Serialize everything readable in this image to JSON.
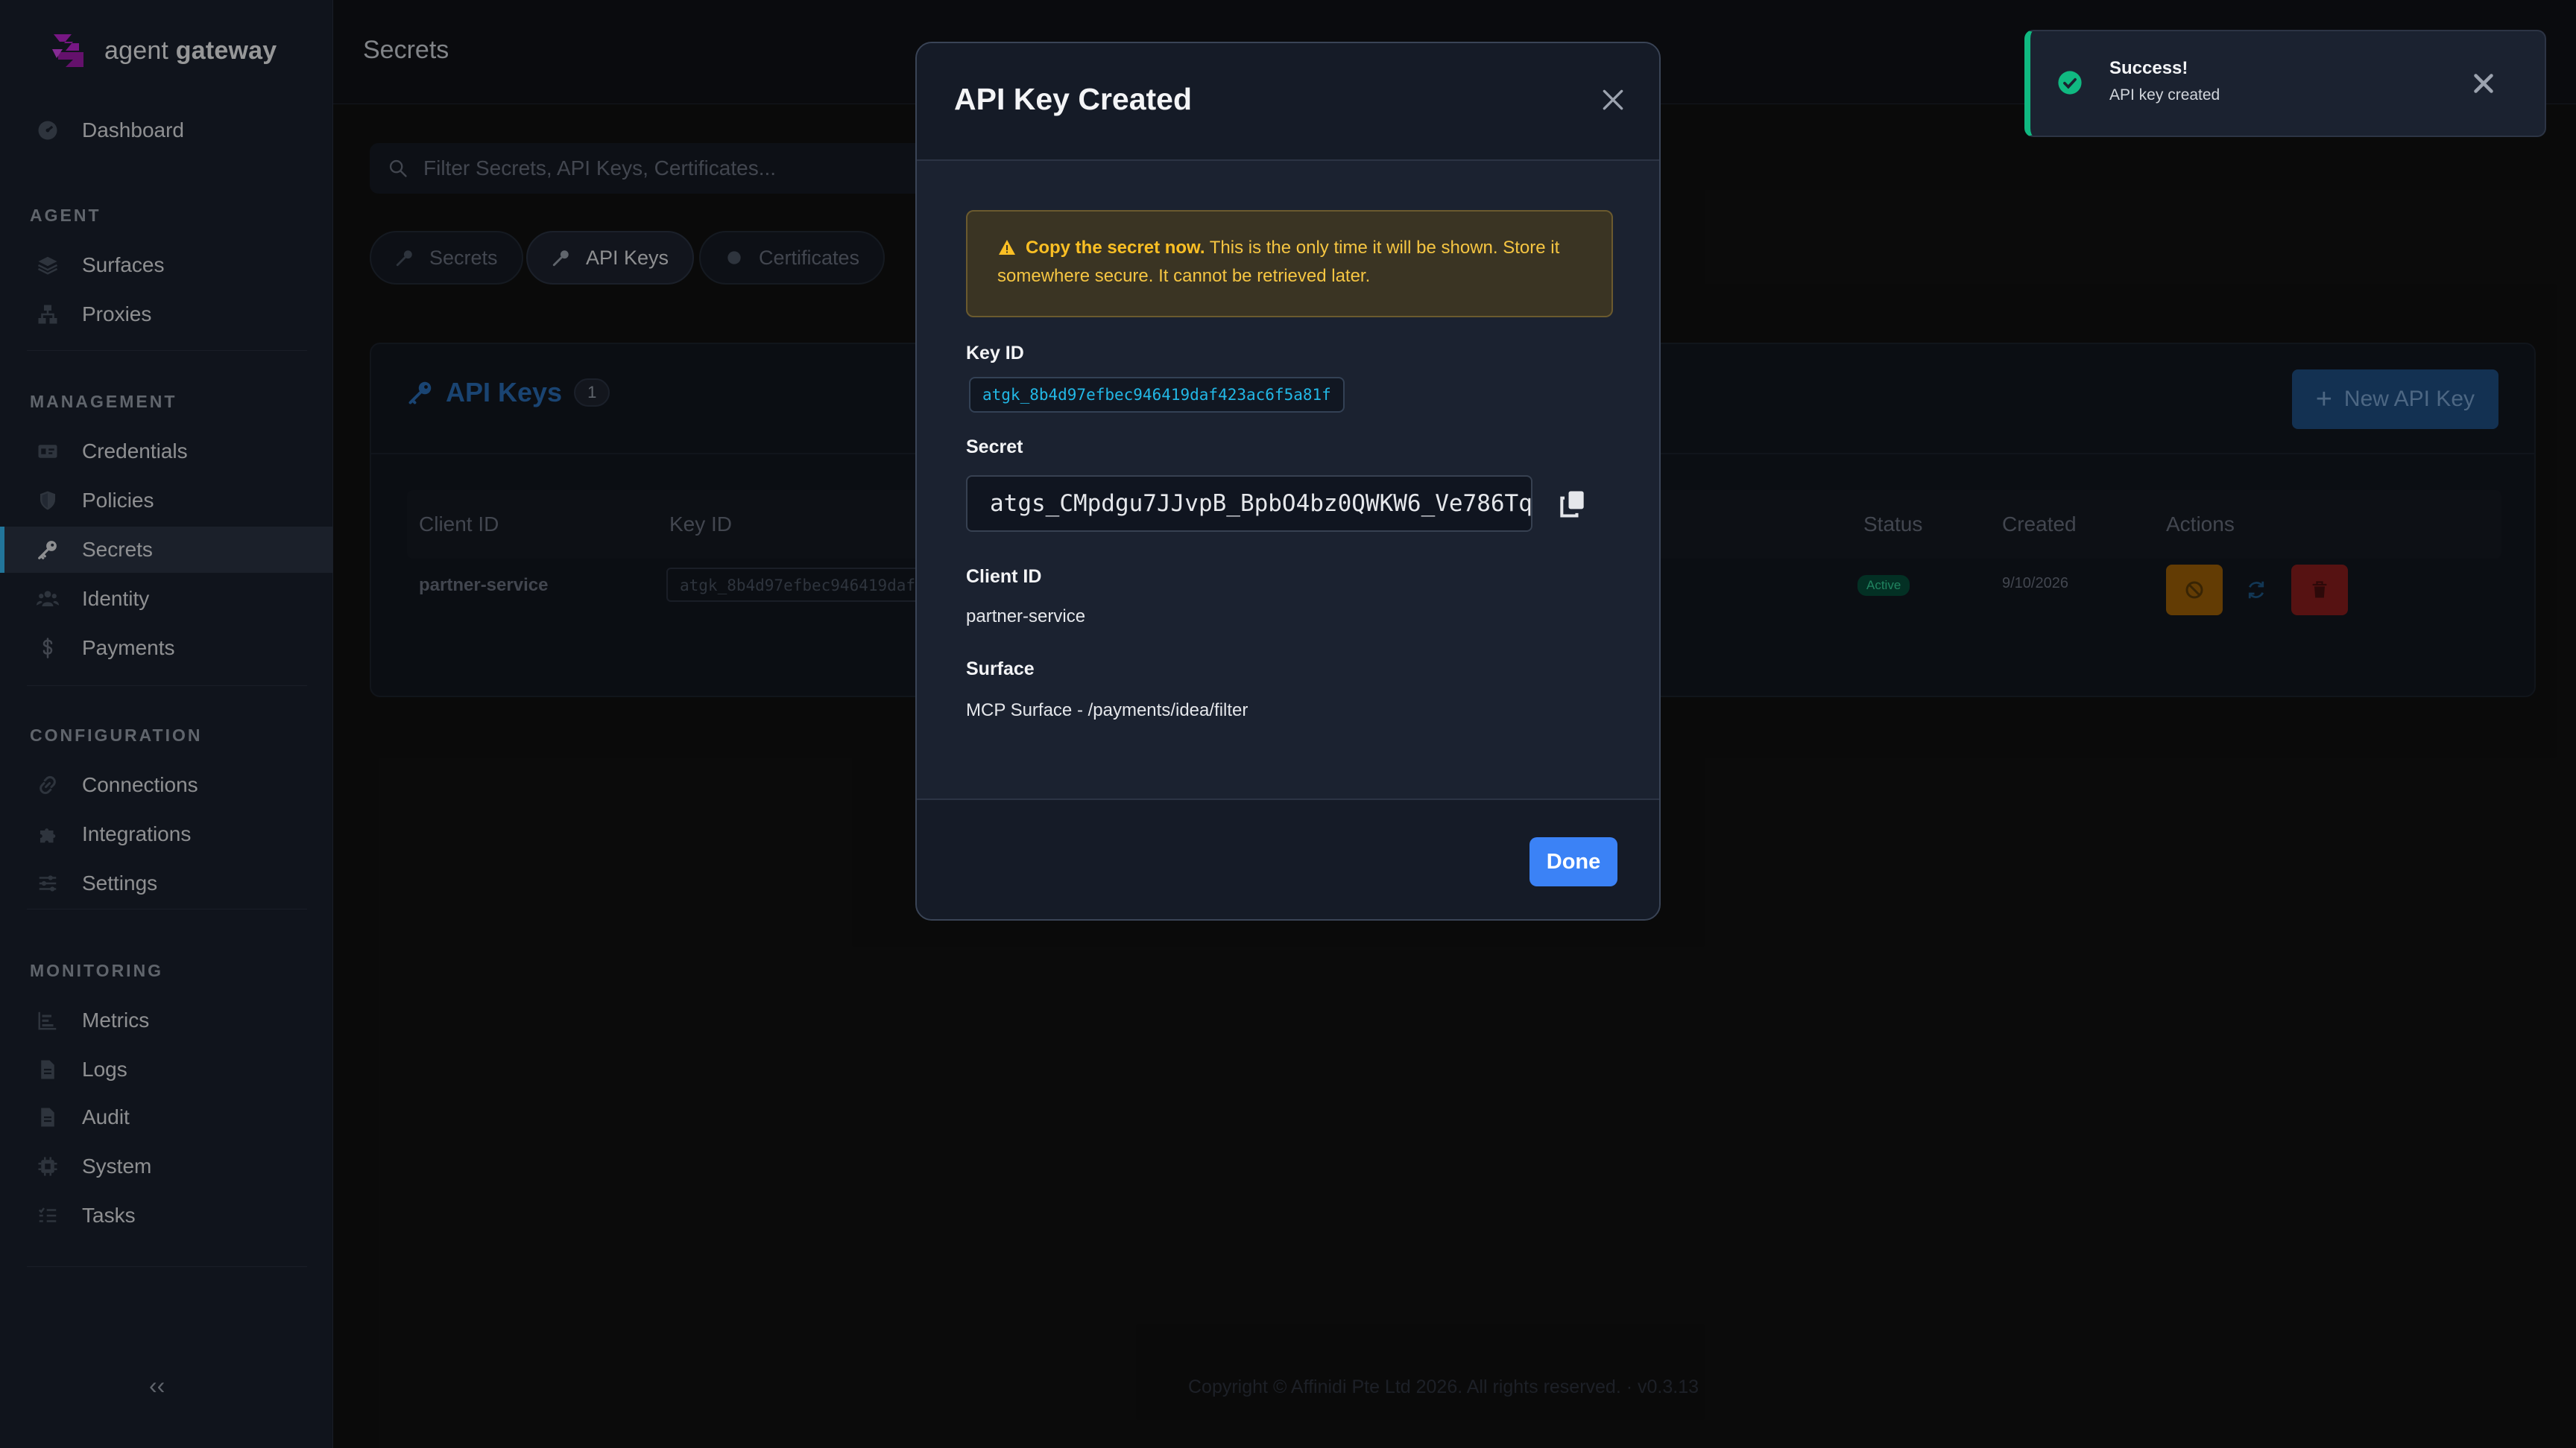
{
  "brand": {
    "name_light": "agent",
    "name_bold": "gateway"
  },
  "sidebar": {
    "dashboard": {
      "label": "Dashboard",
      "icon": "dashboard-icon"
    },
    "sections": [
      {
        "title": "AGENT",
        "items": [
          {
            "label": "Surfaces",
            "icon": "layers-icon"
          },
          {
            "label": "Proxies",
            "icon": "network-icon"
          }
        ]
      },
      {
        "title": "MANAGEMENT",
        "items": [
          {
            "label": "Credentials",
            "icon": "id-card-icon"
          },
          {
            "label": "Policies",
            "icon": "shield-icon"
          },
          {
            "label": "Secrets",
            "icon": "key-icon",
            "active": true
          },
          {
            "label": "Identity",
            "icon": "users-icon"
          },
          {
            "label": "Payments",
            "icon": "dollar-icon"
          }
        ]
      },
      {
        "title": "CONFIGURATION",
        "items": [
          {
            "label": "Connections",
            "icon": "link-icon"
          },
          {
            "label": "Integrations",
            "icon": "puzzle-icon"
          },
          {
            "label": "Settings",
            "icon": "sliders-icon"
          }
        ]
      },
      {
        "title": "MONITORING",
        "items": [
          {
            "label": "Metrics",
            "icon": "bar-chart-icon"
          },
          {
            "label": "Logs",
            "icon": "document-icon"
          },
          {
            "label": "Audit",
            "icon": "document-icon"
          },
          {
            "label": "System",
            "icon": "cpu-icon"
          },
          {
            "label": "Tasks",
            "icon": "list-icon"
          }
        ]
      }
    ],
    "collapse_label": "‹‹"
  },
  "topbar": {
    "title": "Secrets"
  },
  "search": {
    "placeholder": "Filter Secrets, API Keys, Certificates..."
  },
  "tabs": [
    {
      "label": "Secrets",
      "icon": "key-icon",
      "active": false
    },
    {
      "label": "API Keys",
      "icon": "key-icon",
      "active": true
    },
    {
      "label": "Certificates",
      "icon": "certificate-icon",
      "active": false
    }
  ],
  "card": {
    "title": "API Keys",
    "count": "1",
    "new_button": "New API Key",
    "columns": {
      "client_id": "Client ID",
      "key_id": "Key ID",
      "status": "Status",
      "created": "Created",
      "actions": "Actions"
    },
    "rows": [
      {
        "client_id": "partner-service",
        "key_id": "atgk_8b4d97efbec946419daf423ac6f5a81f",
        "status": "Active",
        "created": "9/10/2026"
      }
    ]
  },
  "footer": {
    "text": "Copyright © Affinidi Pte Ltd 2026. All rights reserved. · v0.3.13"
  },
  "modal": {
    "title": "API Key Created",
    "warning_bold": "Copy the secret now.",
    "warning_text": " This is the only time it will be shown. Store it somewhere secure. It cannot be retrieved later.",
    "key_id_label": "Key ID",
    "key_id": "atgk_8b4d97efbec946419daf423ac6f5a81f",
    "secret_label": "Secret",
    "secret": "atgs_CMpdgu7JJvpB_BpbO4bz0QWKW6_Ve786Tq",
    "client_id_label": "Client ID",
    "client_id": "partner-service",
    "surface_label": "Surface",
    "surface": "MCP Surface - /payments/idea/filter",
    "done": "Done"
  },
  "toast": {
    "title": "Success!",
    "message": "API key created"
  },
  "colors": {
    "accent": "#38bdf8",
    "primary_button": "#3b82f6",
    "success": "#10b981",
    "warning": "#fbbf24",
    "danger": "#dc2626"
  }
}
